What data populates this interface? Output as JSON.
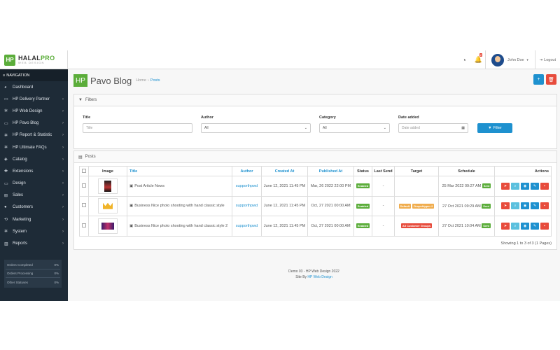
{
  "brand": {
    "name_a": "HALAL",
    "name_b": "PRO",
    "tagline": "WEB DESIGN",
    "mark": "HP"
  },
  "topbar": {
    "notif_count": "2",
    "user_name": "John Doe",
    "logout": "Logout"
  },
  "sidebar": {
    "heading": "NAVIGATION",
    "items": [
      {
        "label": "Dashboard",
        "icon": "dashboard-icon",
        "glyph": "◕",
        "chev": false
      },
      {
        "label": "HP Delivery Partner",
        "icon": "card-icon",
        "glyph": "▭",
        "chev": true
      },
      {
        "label": "HP Web Design",
        "icon": "cogs-icon",
        "glyph": "✲",
        "chev": true
      },
      {
        "label": "HP Pavo Blog",
        "icon": "card-icon",
        "glyph": "▭",
        "chev": true
      },
      {
        "label": "HP Report & Statistic",
        "icon": "cogs-icon",
        "glyph": "✲",
        "chev": true
      },
      {
        "label": "HP Ultimate FAQs",
        "icon": "cogs-icon",
        "glyph": "✲",
        "chev": true
      },
      {
        "label": "Catalog",
        "icon": "tag-icon",
        "glyph": "◈",
        "chev": true
      },
      {
        "label": "Extensions",
        "icon": "puzzle-icon",
        "glyph": "✚",
        "chev": true
      },
      {
        "label": "Design",
        "icon": "monitor-icon",
        "glyph": "▭",
        "chev": true
      },
      {
        "label": "Sales",
        "icon": "cart-icon",
        "glyph": "⊞",
        "chev": true
      },
      {
        "label": "Customers",
        "icon": "user-icon",
        "glyph": "●",
        "chev": true
      },
      {
        "label": "Marketing",
        "icon": "share-icon",
        "glyph": "⟲",
        "chev": true
      },
      {
        "label": "System",
        "icon": "gear-icon",
        "glyph": "✲",
        "chev": true
      },
      {
        "label": "Reports",
        "icon": "bar-chart-icon",
        "glyph": "▥",
        "chev": true
      }
    ],
    "progress": [
      {
        "label": "Orders Completed",
        "value": "0%"
      },
      {
        "label": "Orders Processing",
        "value": "0%"
      },
      {
        "label": "Other Statuses",
        "value": "0%"
      }
    ]
  },
  "page": {
    "logo": "HP",
    "title": "Pavo Blog",
    "crumb_home": "Home",
    "crumb_current": "Posts"
  },
  "filters": {
    "heading": "Filters",
    "title_label": "Title",
    "title_placeholder": "Title",
    "author_label": "Author",
    "author_value": "All",
    "category_label": "Category",
    "category_value": "All",
    "date_label": "Date added",
    "date_placeholder": "Date added",
    "button": "Filter"
  },
  "posts": {
    "heading": "Posts",
    "columns": {
      "image": "Image",
      "title": "Title",
      "author": "Author",
      "created": "Created At",
      "published": "Published At",
      "status": "Status",
      "last_send": "Last Send",
      "target": "Target",
      "schedule": "Schedule",
      "actions": "Actions"
    },
    "rows": [
      {
        "title": "Post Article News",
        "author": "supporthpwd",
        "created": "June 12, 2021 11:45 PM",
        "published": "Mar, 26 2022 22:00 PM",
        "status": "Enabled",
        "last_send": "-",
        "targets": [],
        "schedule": "25 Mar 2022 09:27 AM",
        "sched_badge": "Sent",
        "thumb": "dark"
      },
      {
        "title": "Business Nice photo shooting with hand classic style",
        "author": "supporthpwd",
        "created": "June 12, 2021 11:45 PM",
        "published": "Oct, 27 2021 00:00 AM",
        "status": "Enabled",
        "last_send": "-",
        "targets": [
          {
            "label": "Default",
            "color": "#f0ad4e"
          },
          {
            "label": "Dropshipper 2",
            "color": "#f0ad4e"
          }
        ],
        "schedule": "27 Oct 2021 09:29 AM",
        "sched_badge": "Sent",
        "thumb": "crown"
      },
      {
        "title": "Business Nice photo shooting with hand classic style 2",
        "author": "supporthpwd",
        "created": "June 12, 2021 11:45 PM",
        "published": "Oct, 27 2021 00:00 AM",
        "status": "Enabled",
        "last_send": "-",
        "targets": [
          {
            "label": "All Customer Groups",
            "color": "#e74c3c"
          }
        ],
        "schedule": "27 Oct 2021 10:04 AM",
        "sched_badge": "Sent",
        "thumb": "party"
      }
    ],
    "summary": "Showing 1 to 3 of 3 (1 Pages)"
  },
  "footer": {
    "line1": "Demo 03 - HP Web Design 2022",
    "prefix": "Site By",
    "link": "HP Web Design"
  }
}
